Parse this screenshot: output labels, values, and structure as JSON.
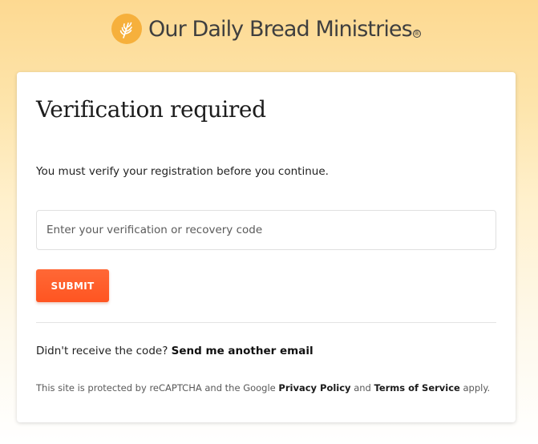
{
  "brand": {
    "name": "Our Daily Bread Ministries",
    "logo_icon": "wheat-icon",
    "registered_mark": "®",
    "logo_color": "#f6b03c"
  },
  "card": {
    "title": "Verification required",
    "description": "You must verify your registration before you continue.",
    "code_input": {
      "value": "",
      "placeholder": "Enter your verification or recovery code"
    },
    "submit_label": "SUBMIT",
    "resend": {
      "prompt": "Didn't receive the code? ",
      "link_label": "Send me another email"
    },
    "legal": {
      "prefix": "This site is protected by reCAPTCHA and the Google ",
      "privacy_label": "Privacy Policy",
      "and": " and ",
      "terms_label": "Terms of Service",
      "suffix": " apply."
    }
  },
  "colors": {
    "accent": "#ff5a26",
    "background_top": "#fdd991"
  }
}
